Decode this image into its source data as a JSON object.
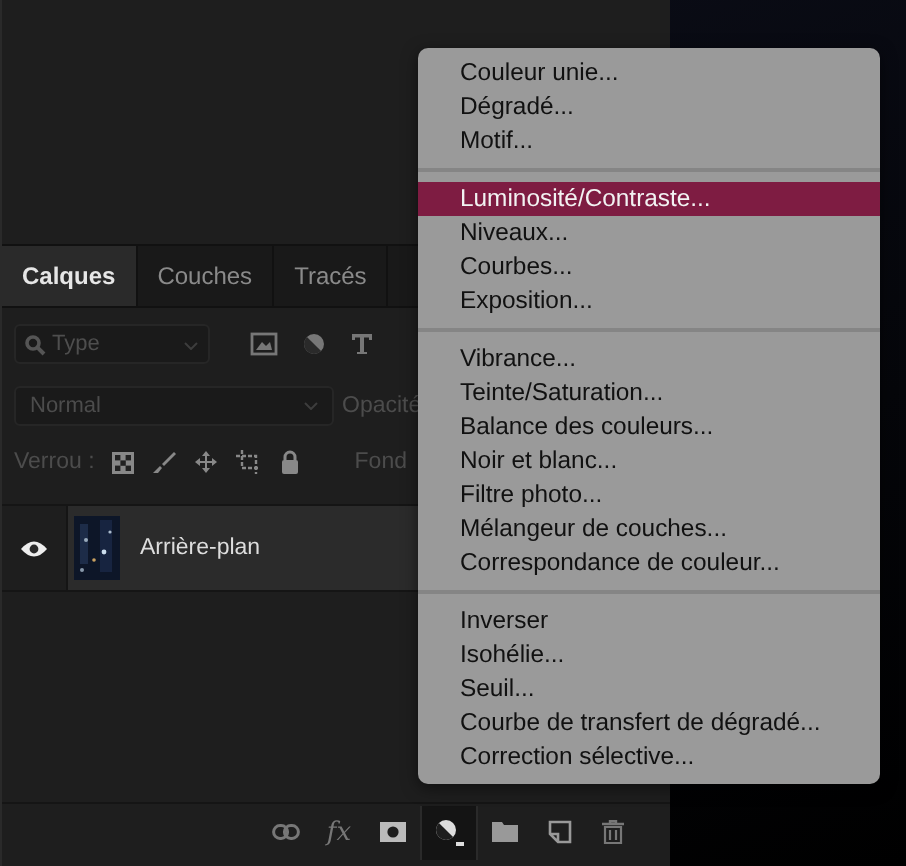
{
  "tabs": [
    {
      "label": "Calques",
      "selected": true
    },
    {
      "label": "Couches",
      "selected": false
    },
    {
      "label": "Tracés",
      "selected": false
    }
  ],
  "filter": {
    "placeholder": "Type"
  },
  "blend_mode": {
    "value": "Normal"
  },
  "opacity_label": "Opacité",
  "lock_label": "Verrou :",
  "fill_label": "Fond",
  "layers": [
    {
      "name": "Arrière-plan",
      "visible": true,
      "selected": true
    }
  ],
  "toolbar": [
    {
      "kind": "link",
      "active": false
    },
    {
      "kind": "fx",
      "label": "fx",
      "active": false
    },
    {
      "kind": "mask",
      "active": false
    },
    {
      "kind": "adjustment",
      "active": true
    },
    {
      "kind": "group",
      "active": false
    },
    {
      "kind": "new",
      "active": false
    },
    {
      "kind": "trash",
      "active": false
    }
  ],
  "menu": {
    "groups": [
      [
        {
          "label": "Couleur unie...",
          "selected": false
        },
        {
          "label": "Dégradé...",
          "selected": false
        },
        {
          "label": "Motif...",
          "selected": false
        }
      ],
      [
        {
          "label": "Luminosité/Contraste...",
          "selected": true
        },
        {
          "label": "Niveaux...",
          "selected": false
        },
        {
          "label": "Courbes...",
          "selected": false
        },
        {
          "label": "Exposition...",
          "selected": false
        }
      ],
      [
        {
          "label": "Vibrance...",
          "selected": false
        },
        {
          "label": "Teinte/Saturation...",
          "selected": false
        },
        {
          "label": "Balance des couleurs...",
          "selected": false
        },
        {
          "label": "Noir et blanc...",
          "selected": false
        },
        {
          "label": "Filtre photo...",
          "selected": false
        },
        {
          "label": "Mélangeur de couches...",
          "selected": false
        },
        {
          "label": "Correspondance de couleur...",
          "selected": false
        }
      ],
      [
        {
          "label": "Inverser",
          "selected": false
        },
        {
          "label": "Isohélie...",
          "selected": false
        },
        {
          "label": "Seuil...",
          "selected": false
        },
        {
          "label": "Courbe de transfert de dégradé...",
          "selected": false
        },
        {
          "label": "Correction sélective...",
          "selected": false
        }
      ]
    ]
  }
}
